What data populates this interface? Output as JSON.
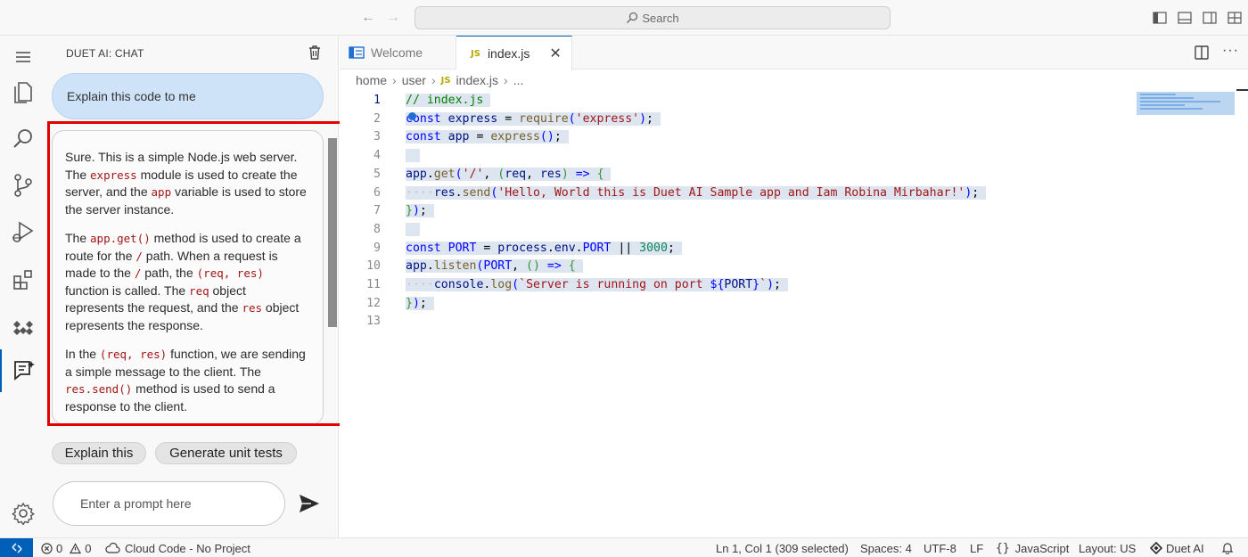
{
  "titlebar": {
    "search_placeholder": "Search"
  },
  "activitybar": {
    "items": [
      "explorer",
      "search",
      "source-control",
      "run-and-debug",
      "extensions",
      "cloud-code",
      "duet-ai-chat",
      "settings"
    ]
  },
  "sidebar": {
    "title": "DUET AI: CHAT",
    "user_message": "Explain this code to me",
    "reply": {
      "p1": {
        "t1": "Sure. This is a simple Node.js web server. The ",
        "c1": "express",
        "t2": " module is used to create the server, and the ",
        "c2": "app",
        "t3": " variable is used to store the server instance."
      },
      "p2": {
        "t1": "The ",
        "c1": "app.get()",
        "t2": " method is used to create a route for the ",
        "c2": "/",
        "t3": " path. When a request is made to the ",
        "c3": "/",
        "t4": " path, the ",
        "c4": "(req, res)",
        "t5": " function is called. The ",
        "c5": "req",
        "t6": " object represents the request, and the ",
        "c6": "res",
        "t7": " object represents the response."
      },
      "p3": {
        "t1": "In the ",
        "c1": "(req, res)",
        "t2": " function, we are sending a simple message to the client. The ",
        "c2": "res.send()",
        "t3": " method is used to send a response to the client."
      }
    },
    "chips": [
      "Explain this",
      "Generate unit tests"
    ],
    "prompt_placeholder": "Enter a prompt here"
  },
  "editor": {
    "tabs": [
      {
        "label": "Welcome",
        "active": false
      },
      {
        "label": "index.js",
        "active": true,
        "badge": "JS"
      }
    ],
    "breadcrumb": [
      "home",
      "user",
      "index.js",
      "..."
    ],
    "code_lines": [
      "// index.js",
      "const express = require('express');",
      "const app = express();",
      "",
      "app.get('/', (req, res) => {",
      "    res.send('Hello, World this is Duet AI Sample app and Iam Robina Mirbahar!');",
      "});",
      "",
      "const PORT = process.env.PORT || 3000;",
      "app.listen(PORT, () => {",
      "    console.log(`Server is running on port ${PORT}`);",
      "});",
      ""
    ],
    "line_numbers": [
      "1",
      "2",
      "3",
      "4",
      "5",
      "6",
      "7",
      "8",
      "9",
      "10",
      "11",
      "12",
      "13"
    ]
  },
  "statusbar": {
    "errors": "0",
    "warnings": "0",
    "cloud_code": "Cloud Code - No Project",
    "cursor": "Ln 1, Col 1 (309 selected)",
    "spaces": "Spaces: 4",
    "encoding": "UTF-8",
    "eol": "LF",
    "language": "JavaScript",
    "layout": "Layout: US",
    "duet": "Duet AI"
  },
  "colors": {
    "accent": "#005fb8",
    "highlight_box": "#e00000",
    "selection": "#dde6f0"
  }
}
